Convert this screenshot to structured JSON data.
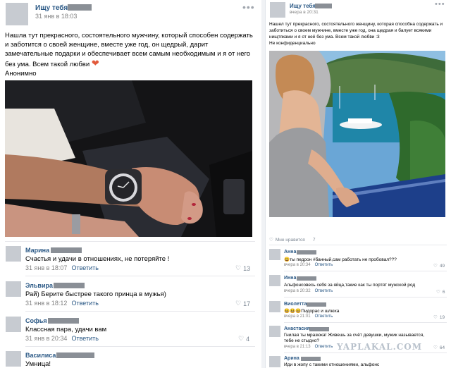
{
  "left_post": {
    "author": "Ищу тебя.",
    "date": "31 янв в 18:03",
    "more": "•••",
    "text": "Нашла тут прекрасного, состоятельного мужчину, который способен содержать и заботится о своей женщине, вместе уже год, он щедрый, дарит замечательные подарки и обеспечивает всем самым необходимым и я от него без ума. Всем такой любви",
    "signature": "Анонимно",
    "comments": [
      {
        "name": "Марина",
        "text": "Счастья и удачи в отношениях, не потеряйте !",
        "date": "31 янв в 18:07",
        "reply": "Ответить",
        "likes": "13"
      },
      {
        "name": "Эльвира",
        "text": "Рай) Берите быстрее такого принца в мужья)",
        "date": "31 янв в 18:12",
        "reply": "Ответить",
        "likes": "17"
      },
      {
        "name": "Софья",
        "text": "Классная пара, удачи вам",
        "date": "31 янв в 20:34",
        "reply": "Ответить",
        "likes": "4"
      },
      {
        "name": "Василиса",
        "text": "Умница!",
        "date": "",
        "reply": "",
        "likes": ""
      }
    ]
  },
  "right_post": {
    "author": "Ищу тебя.",
    "date": "вчера в 20:31",
    "more": "•••",
    "text": "Нашел тут прекрасного, состоятельного женщину, которая способна содержать и заботиться о своем мужчине, вместе уже год, она щедрая и балует всякими нищтяками и я от неё без ума. Всем такой любви :3",
    "signature": "Не конфиденциально",
    "likes_label": "Мне нравится",
    "likes_count": "7",
    "comments": [
      {
        "name": "Анна",
        "text": "ты педрон #банный,сам работать не пробовал???",
        "date": "вчера в 20:34",
        "reply": "Ответить",
        "likes": "49"
      },
      {
        "name": "Инна",
        "text": "Альфонсовесь себя за яйца,такие как ты портят мужской род",
        "date": "вчера в 20:32",
        "reply": "Ответить",
        "likes": "6"
      },
      {
        "name": "Виолетта",
        "text": "Пидорас и шлюха",
        "date": "вчера в 21:01",
        "reply": "Ответить",
        "likes": "19"
      },
      {
        "name": "Анастасия",
        "text": "Гнилая ты мразюка! Живешь за счёт девушки, мужик называется, тебе не стыдно?",
        "date": "вчера в 21:13",
        "reply": "Ответить",
        "likes": "64"
      },
      {
        "name": "Арина",
        "text": "Иди в жопу с такими отношениями, альфонс",
        "date": "",
        "reply": "",
        "likes": ""
      }
    ]
  },
  "watermark": "YAPLAKAL.COM",
  "colors": {
    "link": "#2a5885",
    "meta": "#828282",
    "redaction": "#8a8f96"
  }
}
